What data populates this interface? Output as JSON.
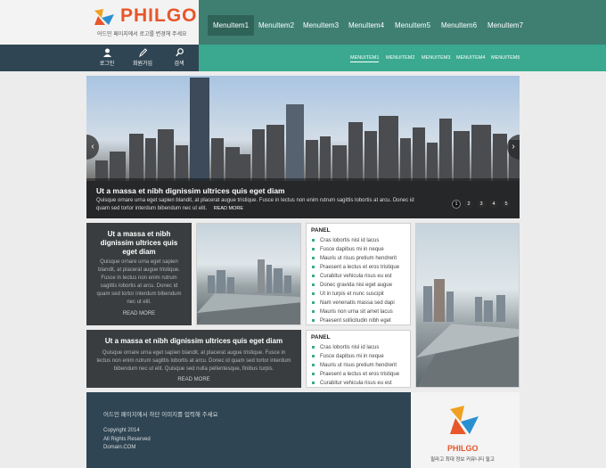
{
  "brand": {
    "name": "PHILGO",
    "subtitle": "어드민 페이지에서 로고를 변경해 주세요",
    "accent": "#e8562a",
    "footer_name": "PHILGO",
    "footer_tagline": "필라고 최대 정보 커뮤니티 필고"
  },
  "colors": {
    "dark_nav": "#2f4553",
    "green": "#3aa98f",
    "top_nav": "#3f7f72"
  },
  "top_menu": [
    {
      "label": "MenuItem1",
      "active": true
    },
    {
      "label": "MenuItem2"
    },
    {
      "label": "MenuItem3"
    },
    {
      "label": "MenuItem4"
    },
    {
      "label": "MenuItem5"
    },
    {
      "label": "MenuItem6"
    },
    {
      "label": "MenuItem7"
    }
  ],
  "user_bar": [
    {
      "icon": "user-icon",
      "label": "로그인"
    },
    {
      "icon": "pencil-icon",
      "label": "회원가입"
    },
    {
      "icon": "search-icon",
      "label": "검색"
    }
  ],
  "sub_menu": [
    {
      "label": "MENUITEM1",
      "active": true
    },
    {
      "label": "MENUITEM2"
    },
    {
      "label": "MENUITEM3"
    },
    {
      "label": "MENUITEM4"
    },
    {
      "label": "MENUITEM5"
    }
  ],
  "slider": {
    "title": "Ut a massa et nibh dignissim ultrices quis eget diam",
    "text": "Quisque ornare urna eget sapien blandit, at placerat augue tristique. Fusce in lectus non enim rutrum sagittis lobortis at arcu. Donec id quam sed tortor interdum bibendum nec ut elit.",
    "more": "READ MORE",
    "dots": [
      "1",
      "2",
      "3",
      "4",
      "5"
    ],
    "prev": "‹",
    "next": "›"
  },
  "card1": {
    "title": "Ut a massa et nibh dignissim ultrices quis eget diam",
    "text": "Quisque ornare urna eget sapien blandit, at placerat augue tristique. Fusce in lectus non enim rutrum sagittis lobortis at arcu. Donec id quam sed tortor interdum bibendum nec ut elit.",
    "more": "READ MORE"
  },
  "card2": {
    "title": "Ut a massa et nibh dignissim ultrices quis eget diam",
    "text": "Quisque ornare urna eget sapien blandit, at placerat augue tristique. Fusce in lectus non enim rutrum sagittis lobortis at arcu. Donec id quam sed tortor interdum bibendum nec ut elit. Quisque sed nulla pellentesque, finibus turpis.",
    "more": "READ MORE"
  },
  "panel1": {
    "title": "PANEL",
    "items": [
      "Cras lobortis nisl id lacus",
      "Fusce dapibus mi in neque",
      "Mauris ut risus pretium hendrerit",
      "Praesent a lectus et eros tristique",
      "Curabitur vehicula risus eu est",
      "Donec gravida nisi eget augue",
      "Ut in turpis et nunc suscipit",
      "Nam venenatis massa sed dapi",
      "Mauris non urna sit amet lacus",
      "Praesent sollicitudin nibh eget"
    ]
  },
  "panel2": {
    "title": "PANEL",
    "items": [
      "Cras lobortis nisl id lacus",
      "Fusce dapibus mi in neque",
      "Mauris ut risus pretium hendrerit",
      "Praesent a lectus et eros tristique",
      "Curabitur vehicula risus eu est"
    ]
  },
  "footer": {
    "notice": "어드민 페이지에서 하단 이미지를 입력해 주세요",
    "copyright": "Copyright 2014",
    "rights": "All Rights Reserved",
    "domain": "Domain.COM"
  }
}
